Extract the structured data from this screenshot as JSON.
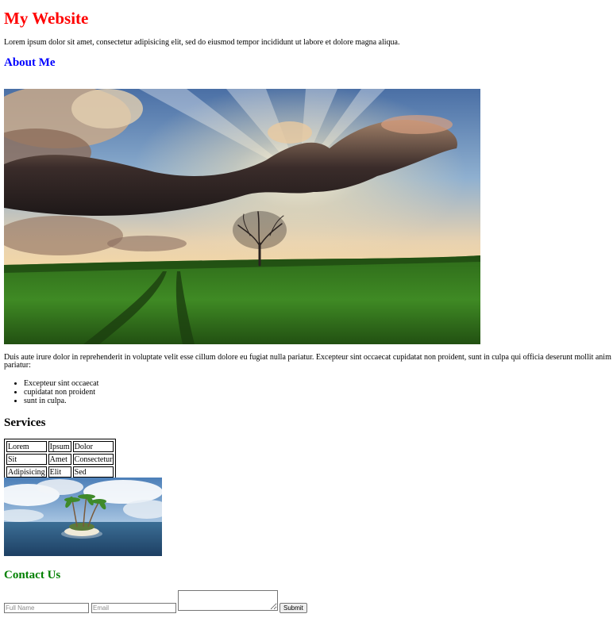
{
  "header": {
    "title": "My Website",
    "intro": "Lorem ipsum dolor sit amet, consectetur adipisicing elit, sed do eiusmod tempor incididunt ut labore et dolore magna aliqua."
  },
  "about": {
    "heading": "About Me",
    "text": "Duis aute irure dolor in reprehenderit in voluptate velit esse cillum dolore eu fugiat nulla pariatur. Excepteur sint occaecat cupidatat non proident, sunt in culpa qui officia deserunt mollit anim pariatur:",
    "items": [
      "Excepteur sint occaecat",
      "cupidatat non proident",
      "sunt in culpa."
    ]
  },
  "services": {
    "heading": "Services",
    "rows": [
      [
        "Lorem",
        "Ipsum",
        "Dolor"
      ],
      [
        "Sit",
        "Amet",
        "Consectetur"
      ],
      [
        "Adipisicing",
        "Elit",
        "Sed"
      ]
    ]
  },
  "contact": {
    "heading": "Contact Us",
    "fullname_placeholder": "Full Name",
    "email_placeholder": "Email",
    "submit_label": "Submit"
  },
  "colors": {
    "title": "#ff0000",
    "about_heading": "#0000ff",
    "contact_heading": "#008000"
  }
}
